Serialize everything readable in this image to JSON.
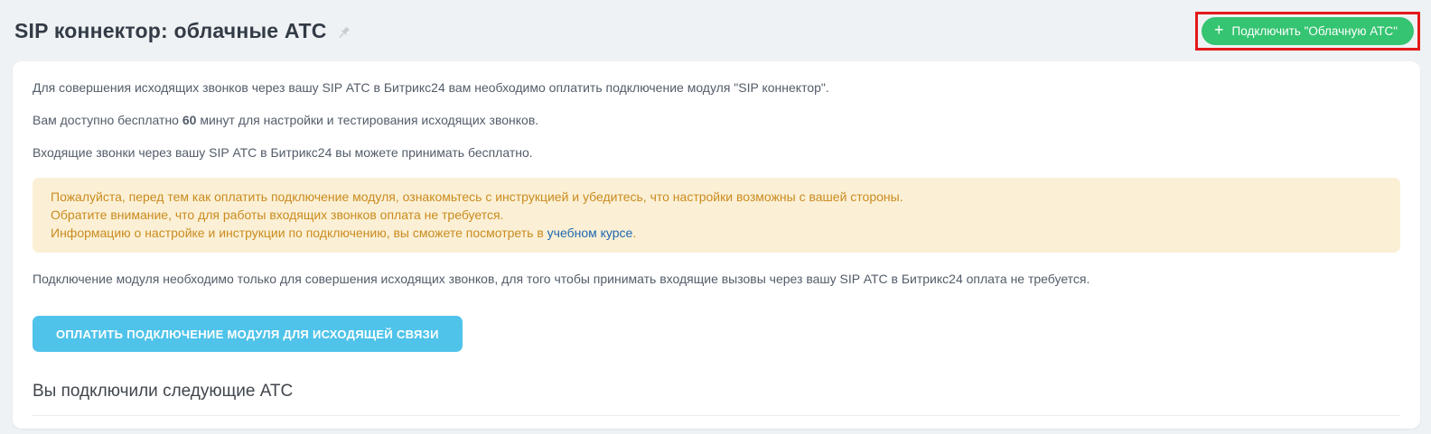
{
  "colors": {
    "page_background": "#eef2f4",
    "accent_green": "#35c471",
    "accent_blue": "#4fc3ea",
    "warning_background": "#fbf0d5",
    "warning_text": "#ca8b1f",
    "link_blue": "#2067b0",
    "highlight_red": "#e31919"
  },
  "header": {
    "title": "SIP коннектор: облачные АТС",
    "pin_icon": "pin-icon",
    "connect_button": {
      "plus": "+",
      "label": "Подключить \"Облачную АТС\""
    }
  },
  "card": {
    "paragraph1": "Для совершения исходящих звонков через вашу SIP АТС в Битрикс24 вам необходимо оплатить подключение модуля \"SIP коннектор\".",
    "paragraph2_before": "Вам доступно бесплатно ",
    "paragraph2_bold": "60",
    "paragraph2_after": " минут для настройки и тестирования исходящих звонков.",
    "paragraph3": "Входящие звонки через вашу SIP АТС в Битрикс24 вы можете принимать бесплатно.",
    "warning": {
      "line1": "Пожалуйста, перед тем как оплатить подключение модуля, ознакомьтесь с инструкцией и убедитесь, что настройки возможны с вашей стороны.",
      "line2": "Обратите внимание, что для работы входящих звонков оплата не требуется.",
      "line3_before": "Информацию о настройке и инструкции по подключению, вы сможете посмотреть в ",
      "line3_link": "учебном курсе",
      "line3_after": "."
    },
    "paragraph4": "Подключение модуля необходимо только для совершения исходящих звонков, для того чтобы принимать входящие вызовы через вашу SIP АТС в Битрикс24 оплата не требуется.",
    "pay_button_label": "ОПЛАТИТЬ ПОДКЛЮЧЕНИЕ МОДУЛЯ ДЛЯ ИСХОДЯЩЕЙ СВЯЗИ",
    "connected_heading": "Вы подключили следующие АТС"
  }
}
